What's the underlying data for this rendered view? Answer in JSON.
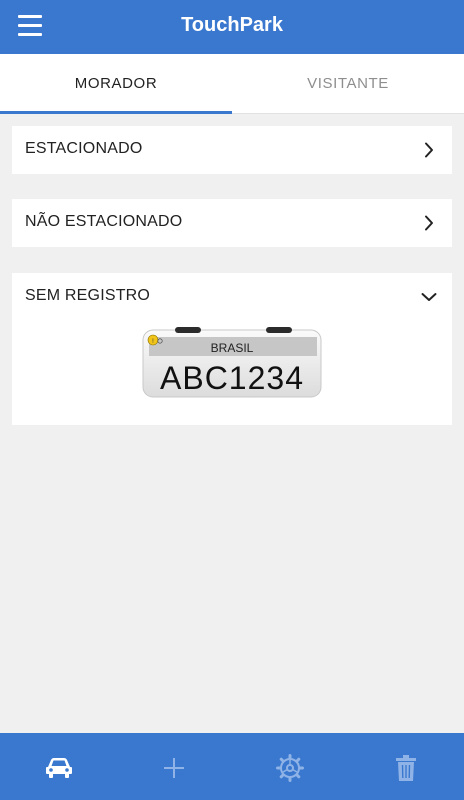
{
  "app": {
    "title": "TouchPark"
  },
  "tabs": [
    {
      "label": "MORADOR",
      "active": true
    },
    {
      "label": "VISITANTE",
      "active": false
    }
  ],
  "sections": [
    {
      "label": "ESTACIONADO",
      "icon": "chevron-right-icon"
    },
    {
      "label": "NÃO ESTACIONADO",
      "icon": "chevron-right-icon"
    },
    {
      "label": "SEM REGISTRO",
      "icon": "chevron-down-icon",
      "expanded": true
    }
  ],
  "plate": {
    "country": "BRASIL",
    "number": "ABC1234"
  },
  "bottom_nav": [
    {
      "icon": "car-icon",
      "active": true
    },
    {
      "icon": "plus-icon",
      "active": false
    },
    {
      "icon": "gear-icon",
      "active": false
    },
    {
      "icon": "trash-icon",
      "active": false
    }
  ],
  "colors": {
    "primary": "#3a78cf",
    "background": "#f0f0f0",
    "inactive_icon": "#8fb3e6"
  }
}
